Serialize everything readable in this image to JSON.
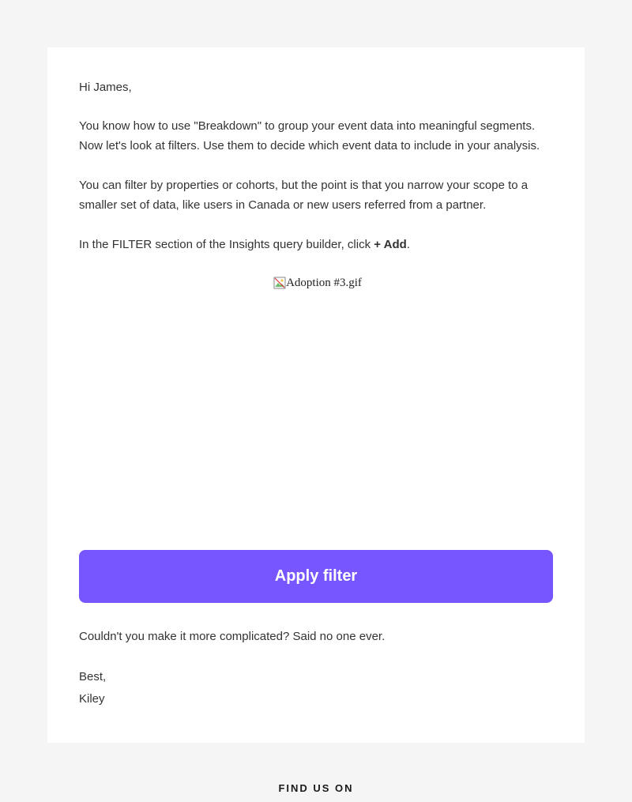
{
  "email": {
    "greeting": "Hi James,",
    "paragraph1": "You know how to use \"Breakdown\" to group your event data into meaningful segments. Now let's look at filters. Use them to decide which event data to include in your analysis.",
    "paragraph2": "You can filter by properties or cohorts, but the point is that you narrow your scope to a smaller set of data, like users in Canada or new users referred from a partner.",
    "paragraph3_prefix": "In the FILTER section of the Insights query builder, click ",
    "paragraph3_bold": "+ Add",
    "paragraph3_suffix": ".",
    "image_alt": "Adoption #3.gif",
    "cta_label": "Apply filter",
    "closing_quip": "Couldn't you make it more complicated? Said no one ever.",
    "signoff": "Best,",
    "sender_name": "Kiley"
  },
  "footer": {
    "find_us_label": "FIND US ON"
  }
}
